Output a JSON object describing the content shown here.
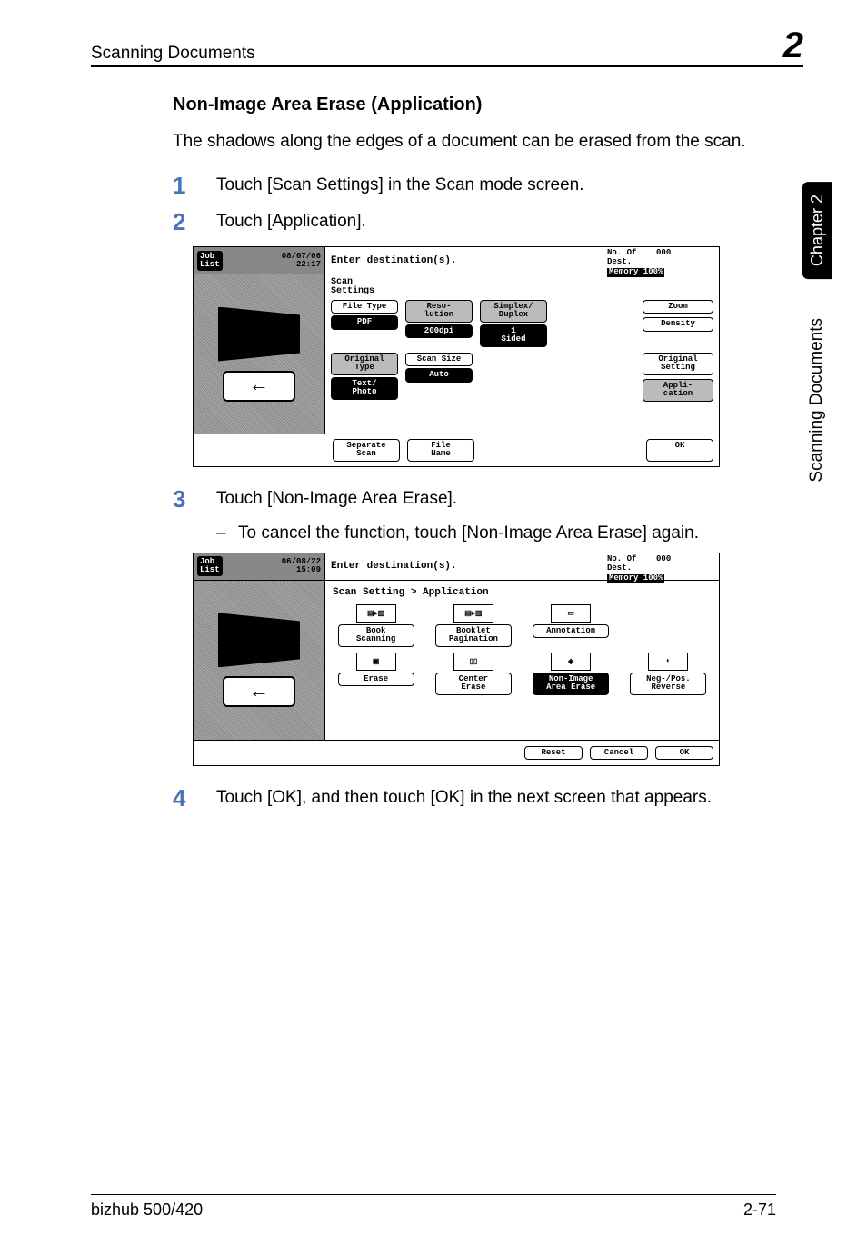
{
  "header": {
    "section": "Scanning Documents",
    "chapter_num": "2"
  },
  "side": {
    "tab": "Chapter 2",
    "label": "Scanning Documents"
  },
  "title": "Non-Image Area Erase (Application)",
  "intro": "The shadows along the edges of a document can be erased from the scan.",
  "steps": {
    "s1": "Touch [Scan Settings] in the Scan mode screen.",
    "s2": "Touch [Application].",
    "s3": "Touch [Non-Image Area Erase].",
    "s3_sub": "To cancel the function, touch [Non-Image Area Erase] again.",
    "s4": "Touch [OK], and then touch [OK] in the next screen that appears."
  },
  "lcd1": {
    "joblist": "Job\nList",
    "datetime": "08/07/06\n22:17",
    "enter": "Enter destination(s).",
    "status_l1": "No. Of",
    "status_l2": "Dest.",
    "status_count": "000",
    "status_mem": "Memory 100%",
    "scan_settings": "Scan\nSettings",
    "file_type": "File Type",
    "pdf": "PDF",
    "resolution": "Reso-\nlution",
    "dpi": "200dpi",
    "simplex": "Simplex/\nDuplex",
    "sided": "1\nSided",
    "orig_type": "Original\nType",
    "textphoto": "Text/\nPhoto",
    "scan_size": "Scan Size",
    "auto": "Auto",
    "zoom": "Zoom",
    "density": "Density",
    "orig_setting": "Original\nSetting",
    "application": "Appli-\ncation",
    "separate": "Separate\nScan",
    "filename": "File\nName",
    "ok": "OK"
  },
  "lcd2": {
    "joblist": "Job\nList",
    "datetime": "06/08/22\n15:09",
    "enter": "Enter destination(s).",
    "status_l1": "No. Of",
    "status_l2": "Dest.",
    "status_count": "000",
    "status_mem": "Memory 100%",
    "breadcrumb": "Scan Setting > Application",
    "book_scanning": "Book\nScanning",
    "booklet_pag": "Booklet\nPagination",
    "annotation": "Annotation",
    "erase": "Erase",
    "center_erase": "Center\nErase",
    "non_image": "Non-Image\nArea Erase",
    "negpos": "Neg-/Pos.\nReverse",
    "reset": "Reset",
    "cancel": "Cancel",
    "ok": "OK"
  },
  "footer": {
    "model": "bizhub 500/420",
    "page": "2-71"
  }
}
